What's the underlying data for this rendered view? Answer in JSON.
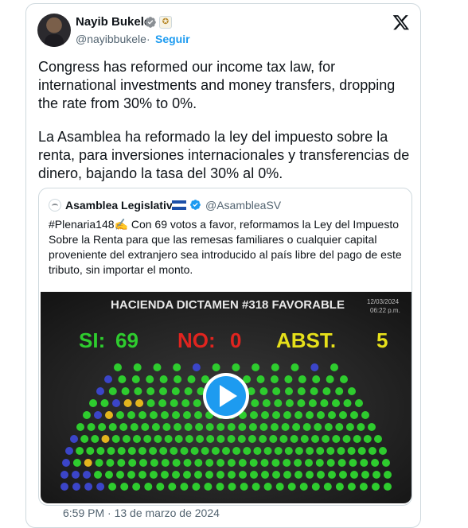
{
  "author": {
    "name": "Nayib Bukele",
    "handle": "@nayibbukele",
    "separator": "·",
    "follow_label": "Seguir"
  },
  "post": {
    "text_en": "Congress has reformed our income tax law, for international investments and money transfers, dropping the rate from 30% to 0%.",
    "text_es": "La Asamblea ha reformado la ley del impuesto sobre la renta, para inversiones internacionales y transferencias de dinero, bajando la tasa del 30% al 0%."
  },
  "quote": {
    "name": "Asamblea Legislativa",
    "handle": "@AsambleaSV",
    "hashtag": "#Plenaria148",
    "text": " Con 69 votos a favor, reformamos la Ley del Impuesto Sobre la Renta para que las remesas familiares o cualquier capital proveniente del extranjero sea introducido al país libre del pago de este tributo, sin importar el monto."
  },
  "video": {
    "heading": "HACIENDA DICTAMEN #318 FAVORABLE",
    "date": "12/03/2024",
    "time": "06:22 p.m.",
    "si_label": "SI:",
    "si_value": "69",
    "no_label": "NO:",
    "no_value": "0",
    "abst_label": "ABST.",
    "abst_value": "5",
    "colors": {
      "yes": "#2ecc2e",
      "no": "#e0241f",
      "abst": "#e6e01a",
      "yellow_seat": "#e3b51e",
      "blue_seat": "#3b45c8",
      "play": "#1d9bf0"
    }
  },
  "footer": {
    "timestamp": "6:59 PM · 13 de marzo de 2024"
  }
}
